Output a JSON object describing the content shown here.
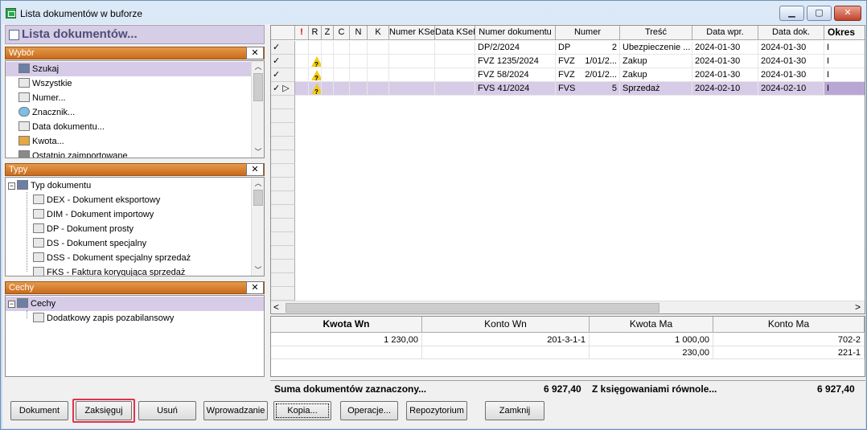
{
  "window": {
    "title": "Lista dokumentów w buforze",
    "min_label": "▁",
    "max_label": "▢",
    "close_label": "✕"
  },
  "left": {
    "header": "Lista dokumentów...",
    "wybor": {
      "title": "Wybór",
      "items": [
        {
          "label": "Szukaj",
          "icon": "binoculars-icon"
        },
        {
          "label": "Wszystkie",
          "icon": "list-icon"
        },
        {
          "label": "Numer...",
          "icon": "list-icon"
        },
        {
          "label": "Znacznik...",
          "icon": "marker-icon"
        },
        {
          "label": "Data dokumentu...",
          "icon": "list-icon"
        },
        {
          "label": "Kwota...",
          "icon": "coins-icon"
        },
        {
          "label": "Ostatnio zaimportowane",
          "icon": "import-icon"
        }
      ]
    },
    "typy": {
      "title": "Typy",
      "root": "Typ dokumentu",
      "items": [
        "DEX - Dokument eksportowy",
        "DIM - Dokument importowy",
        "DP - Dokument prosty",
        "DS - Dokument specjalny",
        "DSS - Dokument specjalny sprzedaż",
        "FKS - Faktura korygująca sprzedaż"
      ]
    },
    "cechy": {
      "title": "Cechy",
      "root": "Cechy",
      "items": [
        "Dodatkowy zapis pozabilansowy"
      ]
    }
  },
  "grid": {
    "columns": [
      "",
      "!",
      "R",
      "Z",
      "C",
      "N",
      "K",
      "Numer KSeF",
      "Data KSeF",
      "Numer dokumentu",
      "Numer",
      "Treść",
      "Data wpr.",
      "Data dok.",
      "Okres"
    ],
    "rows": [
      {
        "mark": "✓",
        "warn": false,
        "numer_dokumentu": "DP/2/2024",
        "typ": "DP",
        "nr": "2",
        "tresc": "Ubezpieczenie ...",
        "data_wpr": "2024-01-30",
        "data_dok": "2024-01-30",
        "okres": "I",
        "selected": false
      },
      {
        "mark": "✓",
        "warn": true,
        "numer_dokumentu": "FVZ 1235/2024",
        "typ": "FVZ",
        "nr": "1/01/2...",
        "tresc": "Zakup",
        "data_wpr": "2024-01-30",
        "data_dok": "2024-01-30",
        "okres": "I",
        "selected": false
      },
      {
        "mark": "✓",
        "warn": true,
        "numer_dokumentu": "FVZ 58/2024",
        "typ": "FVZ",
        "nr": "2/01/2...",
        "tresc": "Zakup",
        "data_wpr": "2024-01-30",
        "data_dok": "2024-01-30",
        "okres": "I",
        "selected": false
      },
      {
        "mark": "✓ ▷",
        "warn": true,
        "numer_dokumentu": "FVS 41/2024",
        "typ": "FVS",
        "nr": "5",
        "tresc": "Sprzedaż",
        "data_wpr": "2024-02-10",
        "data_dok": "2024-02-10",
        "okres": "I",
        "selected": true
      }
    ],
    "scroll_left": "<",
    "scroll_right": ">"
  },
  "kwota": {
    "columns": [
      "Kwota Wn",
      "Konto Wn",
      "Kwota Ma",
      "Konto Ma"
    ],
    "rows": [
      [
        "1 230,00",
        "201-3-1-1",
        "1 000,00",
        "702-2"
      ],
      [
        "",
        "",
        "230,00",
        "221-1"
      ]
    ]
  },
  "summary": {
    "label1": "Suma dokumentów zaznaczony...",
    "value1": "6 927,40",
    "label2": "Z księgowaniami równole...",
    "value2": "6 927,40"
  },
  "buttons": {
    "dokument": "Dokument",
    "zaksieguj": "Zaksięguj",
    "usun": "Usuń",
    "wprowadzanie": "Wprowadzanie",
    "kopia": "Kopia...",
    "operacje": "Operacje...",
    "repozytorium": "Repozytorium",
    "zamknij": "Zamknij"
  },
  "colors": {
    "selection": "#d7cce8",
    "section_header": "#d27a2a",
    "highlight_box": "#e0334f"
  }
}
